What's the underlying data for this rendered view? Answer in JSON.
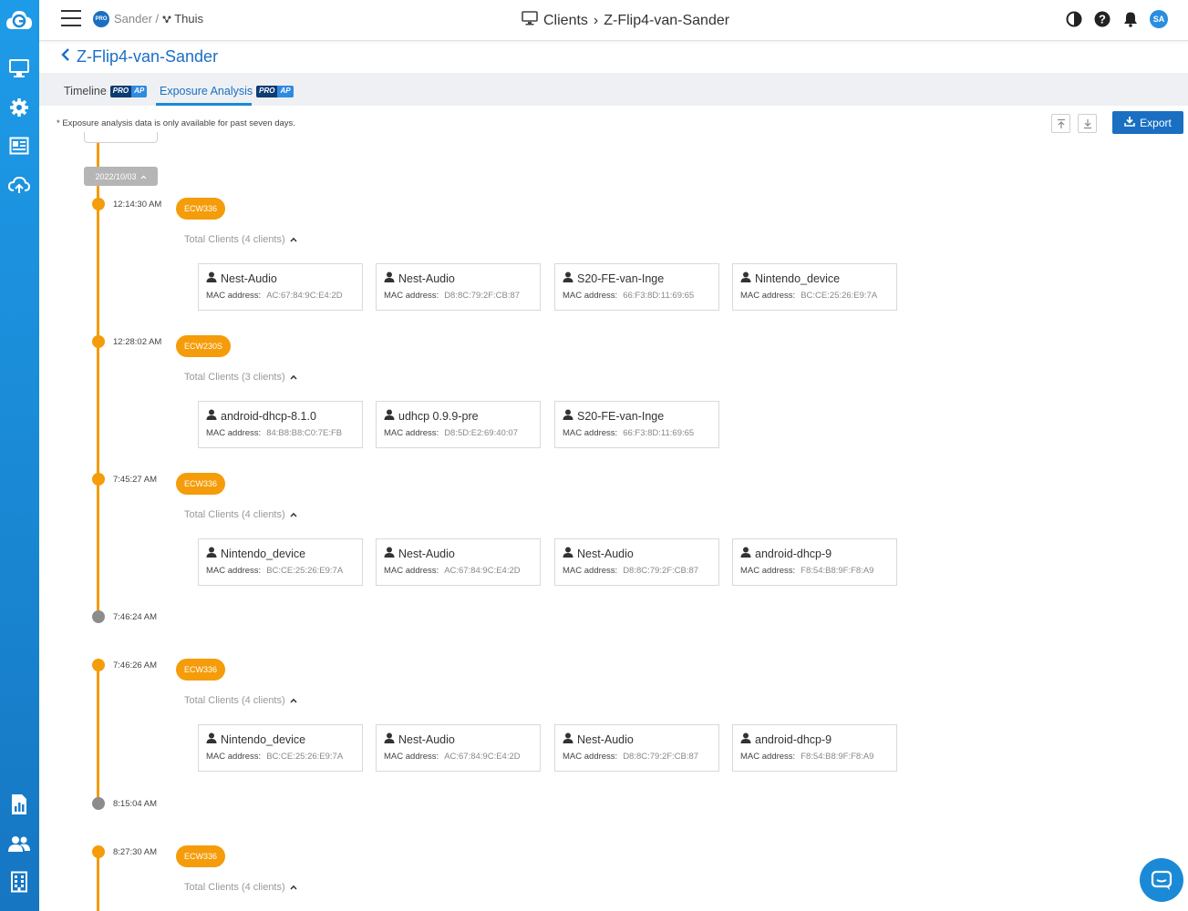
{
  "header": {
    "org_name": "Sander",
    "separator": "/",
    "site_name": "Thuis",
    "org_badge": "PRO",
    "page_section": "Clients",
    "page_chevron": "›",
    "page_name": "Z-Flip4-van-Sander",
    "avatar_initials": "SA",
    "icons": [
      "contrast-icon",
      "help-icon",
      "bell-icon"
    ]
  },
  "sidebar": {
    "items": [
      "monitor-icon",
      "settings-icon",
      "dashboard-icon",
      "cloud-icon",
      "report-icon",
      "users-icon",
      "building-icon"
    ]
  },
  "title": "Z-Flip4-van-Sander",
  "tabs": [
    {
      "label": "Timeline",
      "tag_pro": "PRO",
      "tag_ap": "AP",
      "active": false
    },
    {
      "label": "Exposure Analysis",
      "tag_pro": "PRO",
      "tag_ap": "AP",
      "active": true
    }
  ],
  "note": "* Exposure analysis data is only available for past seven days.",
  "export_label": "Export",
  "mac_label": "MAC address:",
  "timeline": {
    "date": "2022/10/03",
    "events": [
      {
        "time": "12:14:30 AM",
        "ap": "ECW336",
        "total": "Total Clients (4 clients)",
        "clients": [
          {
            "name": "Nest-Audio",
            "mac": "AC:67:84:9C:E4:2D"
          },
          {
            "name": "Nest-Audio",
            "mac": "D8:8C:79:2F:CB:87"
          },
          {
            "name": "S20-FE-van-Inge",
            "mac": "66:F3:8D:11:69:65"
          },
          {
            "name": "Nintendo_device",
            "mac": "BC:CE:25:26:E9:7A"
          }
        ]
      },
      {
        "time": "12:28:02 AM",
        "ap": "ECW230S",
        "total": "Total Clients (3 clients)",
        "clients": [
          {
            "name": "android-dhcp-8.1.0",
            "mac": "84:B8:B8:C0:7E:FB"
          },
          {
            "name": "udhcp 0.9.9-pre",
            "mac": "D8:5D:E2:69:40:07"
          },
          {
            "name": "S20-FE-van-Inge",
            "mac": "66:F3:8D:11:69:65"
          }
        ]
      },
      {
        "time": "7:45:27 AM",
        "ap": "ECW336",
        "total": "Total Clients (4 clients)",
        "clients": [
          {
            "name": "Nintendo_device",
            "mac": "BC:CE:25:26:E9:7A"
          },
          {
            "name": "Nest-Audio",
            "mac": "AC:67:84:9C:E4:2D"
          },
          {
            "name": "Nest-Audio",
            "mac": "D8:8C:79:2F:CB:87"
          },
          {
            "name": "android-dhcp-9",
            "mac": "F8:54:B8:9F:F8:A9"
          }
        ]
      },
      {
        "time": "7:46:24 AM",
        "end": true
      },
      {
        "time": "7:46:26 AM",
        "ap": "ECW336",
        "total": "Total Clients (4 clients)",
        "clients": [
          {
            "name": "Nintendo_device",
            "mac": "BC:CE:25:26:E9:7A"
          },
          {
            "name": "Nest-Audio",
            "mac": "AC:67:84:9C:E4:2D"
          },
          {
            "name": "Nest-Audio",
            "mac": "D8:8C:79:2F:CB:87"
          },
          {
            "name": "android-dhcp-9",
            "mac": "F8:54:B8:9F:F8:A9"
          }
        ]
      },
      {
        "time": "8:15:04 AM",
        "end": true
      },
      {
        "time": "8:27:30 AM",
        "ap": "ECW336",
        "total": "Total Clients (4 clients)",
        "clients": []
      }
    ]
  },
  "colors": {
    "accent": "#1a6fc3",
    "timeline": "#f59c0a",
    "end_dot": "#8c8c8c"
  }
}
